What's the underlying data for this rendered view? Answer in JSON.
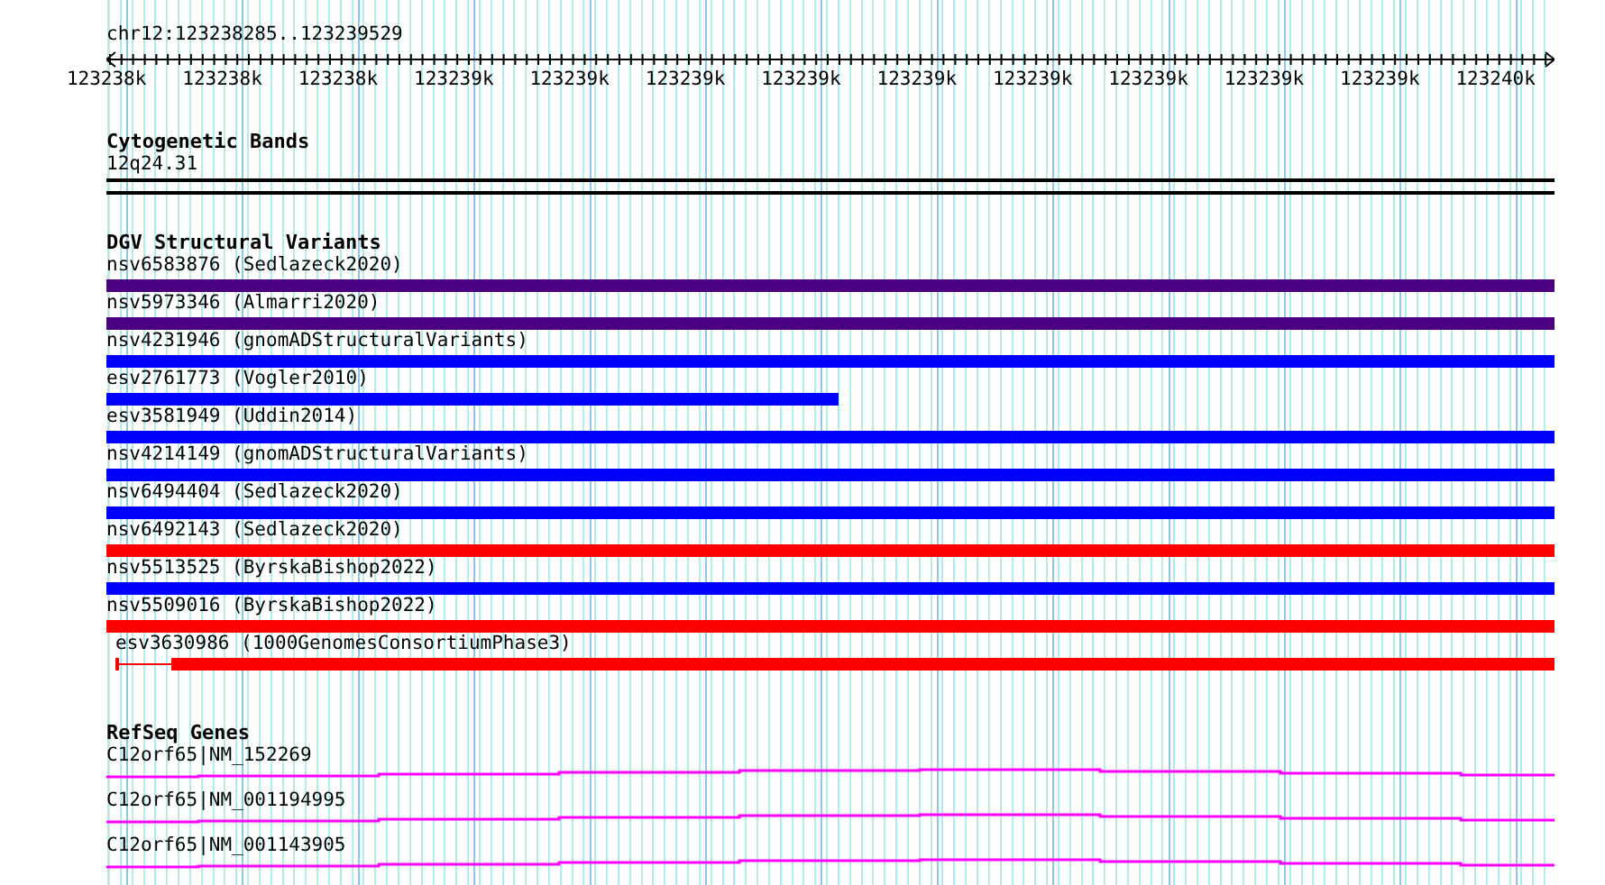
{
  "ruler": {
    "location": "chr12:123238285..123239529",
    "ticks": [
      "123238k",
      "123238k",
      "123238k",
      "123239k",
      "123239k",
      "123239k",
      "123239k",
      "123239k",
      "123239k",
      "123239k",
      "123239k",
      "123239k",
      "123240k"
    ]
  },
  "tracks": [
    {
      "kind": "cytoband",
      "title": "Cytogenetic Bands",
      "features": [
        {
          "label": "12q24.31"
        }
      ]
    },
    {
      "kind": "variants",
      "title": "DGV Structural Variants",
      "features": [
        {
          "label": "nsv6583876 (Sedlazeck2020)",
          "color": "#4b0082",
          "kind": "full"
        },
        {
          "label": "nsv5973346 (Almarri2020)",
          "color": "#4b0082",
          "kind": "full"
        },
        {
          "label": "nsv4231946 (gnomADStructuralVariants)",
          "color": "#0000ff",
          "kind": "full"
        },
        {
          "label": "esv2761773 (Vogler2010)",
          "color": "#0000ff",
          "kind": "partial"
        },
        {
          "label": "esv3581949 (Uddin2014)",
          "color": "#0000ff",
          "kind": "full"
        },
        {
          "label": "nsv4214149 (gnomADStructuralVariants)",
          "color": "#0000ff",
          "kind": "full"
        },
        {
          "label": "nsv6494404 (Sedlazeck2020)",
          "color": "#0000ff",
          "kind": "full"
        },
        {
          "label": "nsv6492143 (Sedlazeck2020)",
          "color": "#ff0000",
          "kind": "full"
        },
        {
          "label": "nsv5513525 (ByrskaBishop2022)",
          "color": "#0000ff",
          "kind": "full"
        },
        {
          "label": "nsv5509016 (ByrskaBishop2022)",
          "color": "#ff0000",
          "kind": "full"
        },
        {
          "label": "esv3630986 (1000GenomesConsortiumPhase3)",
          "color": "#ff0000",
          "kind": "gapped"
        }
      ]
    },
    {
      "kind": "genes",
      "title": "RefSeq Genes",
      "features": [
        {
          "label": "C12orf65|NM_152269"
        },
        {
          "label": "C12orf65|NM_001194995"
        },
        {
          "label": "C12orf65|NM_001143905"
        }
      ]
    }
  ]
}
